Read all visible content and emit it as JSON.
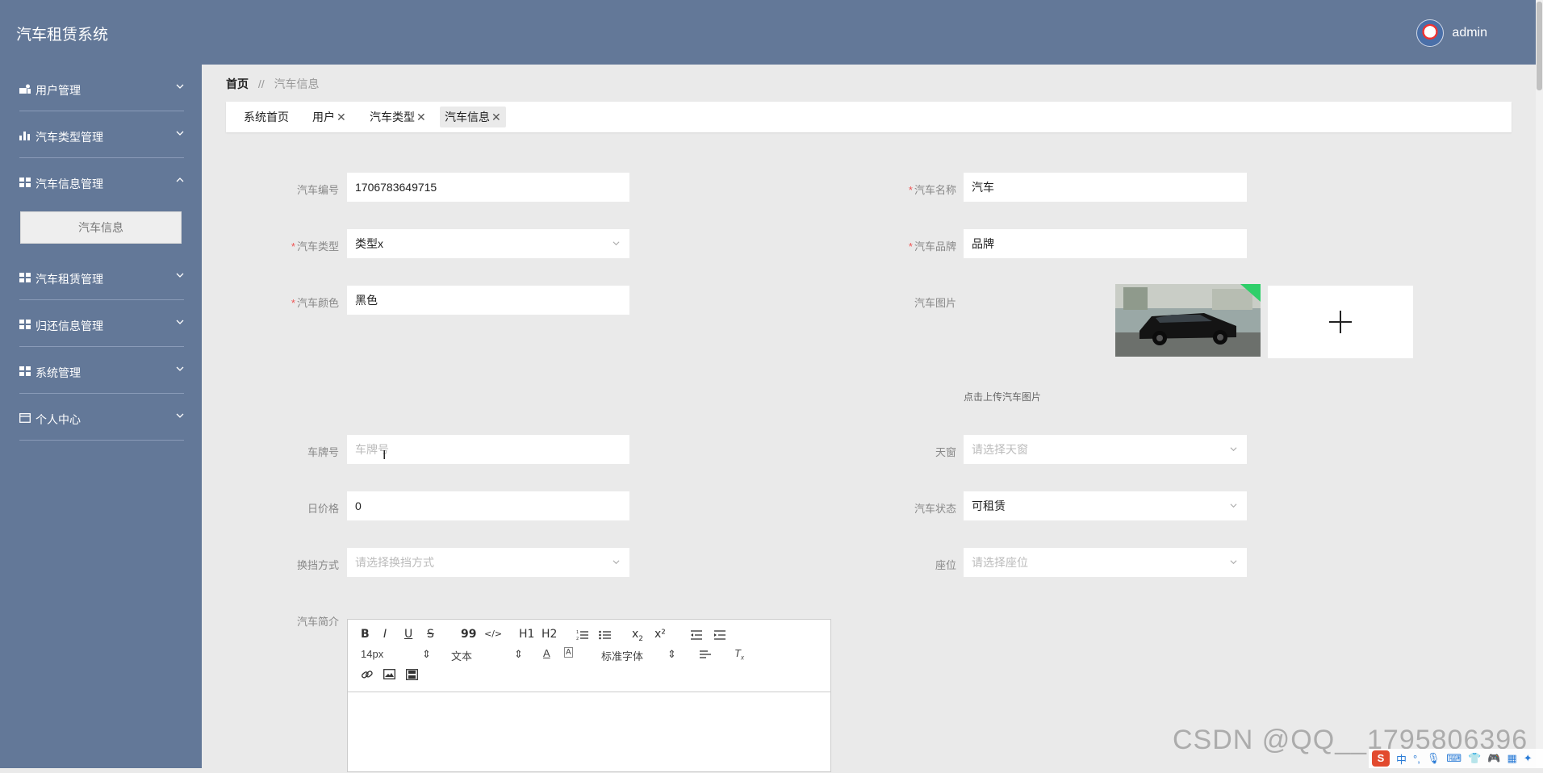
{
  "app": {
    "title": "汽车租赁系统",
    "user_name": "admin"
  },
  "sidebar": {
    "items": [
      {
        "label": "用户管理",
        "icon": "user-group-icon"
      },
      {
        "label": "汽车类型管理",
        "icon": "bar-chart-icon"
      },
      {
        "label": "汽车信息管理",
        "icon": "grid-icon",
        "expanded": true,
        "sub": [
          "汽车信息"
        ]
      },
      {
        "label": "汽车租赁管理",
        "icon": "grid-icon"
      },
      {
        "label": "归还信息管理",
        "icon": "grid-icon"
      },
      {
        "label": "系统管理",
        "icon": "grid-icon"
      },
      {
        "label": "个人中心",
        "icon": "card-icon"
      }
    ]
  },
  "breadcrumb": {
    "home": "首页",
    "separator": "//",
    "current": "汽车信息"
  },
  "tabs": [
    {
      "label": "系统首页",
      "closable": false
    },
    {
      "label": "用户",
      "closable": true
    },
    {
      "label": "汽车类型",
      "closable": true
    },
    {
      "label": "汽车信息",
      "closable": true,
      "active": true
    }
  ],
  "form": {
    "car_no": {
      "label": "汽车编号",
      "value": "1706783649715"
    },
    "car_name": {
      "label": "汽车名称",
      "value": "汽车",
      "required": true
    },
    "car_type": {
      "label": "汽车类型",
      "value": "类型x",
      "required": true
    },
    "car_brand": {
      "label": "汽车品牌",
      "value": "品牌",
      "required": true
    },
    "car_color": {
      "label": "汽车颜色",
      "value": "黑色",
      "required": true
    },
    "car_image": {
      "label": "汽车图片",
      "hint": "点击上传汽车图片"
    },
    "plate": {
      "label": "车牌号",
      "placeholder": "车牌号"
    },
    "sunroof": {
      "label": "天窗",
      "placeholder": "请选择天窗"
    },
    "daily_price": {
      "label": "日价格",
      "value": "0"
    },
    "status": {
      "label": "汽车状态",
      "value": "可租赁"
    },
    "gearbox": {
      "label": "换挡方式",
      "placeholder": "请选择换挡方式"
    },
    "seats": {
      "label": "座位",
      "placeholder": "请选择座位"
    },
    "intro": {
      "label": "汽车简介"
    }
  },
  "editor": {
    "font_size": "14px",
    "paragraph": "文本",
    "font_family": "标准字体",
    "buttons_row1": [
      "B",
      "I",
      "U",
      "S",
      "99",
      "</>",
      "H1",
      "H2",
      "ol",
      "ul",
      "x2",
      "x²",
      "outdent",
      "indent"
    ],
    "buttons_row3": [
      "link",
      "image",
      "video"
    ]
  },
  "watermark": "CSDN @QQ__1795806396",
  "tray": [
    "S",
    "中",
    "°,",
    "mic",
    "keyboard",
    "shirt",
    "gamepad",
    "grid",
    "more"
  ],
  "colors": {
    "header_bg": "#637898",
    "sidebar_bg": "#637898",
    "page_bg": "#eaeaea",
    "required": "#e55555"
  }
}
